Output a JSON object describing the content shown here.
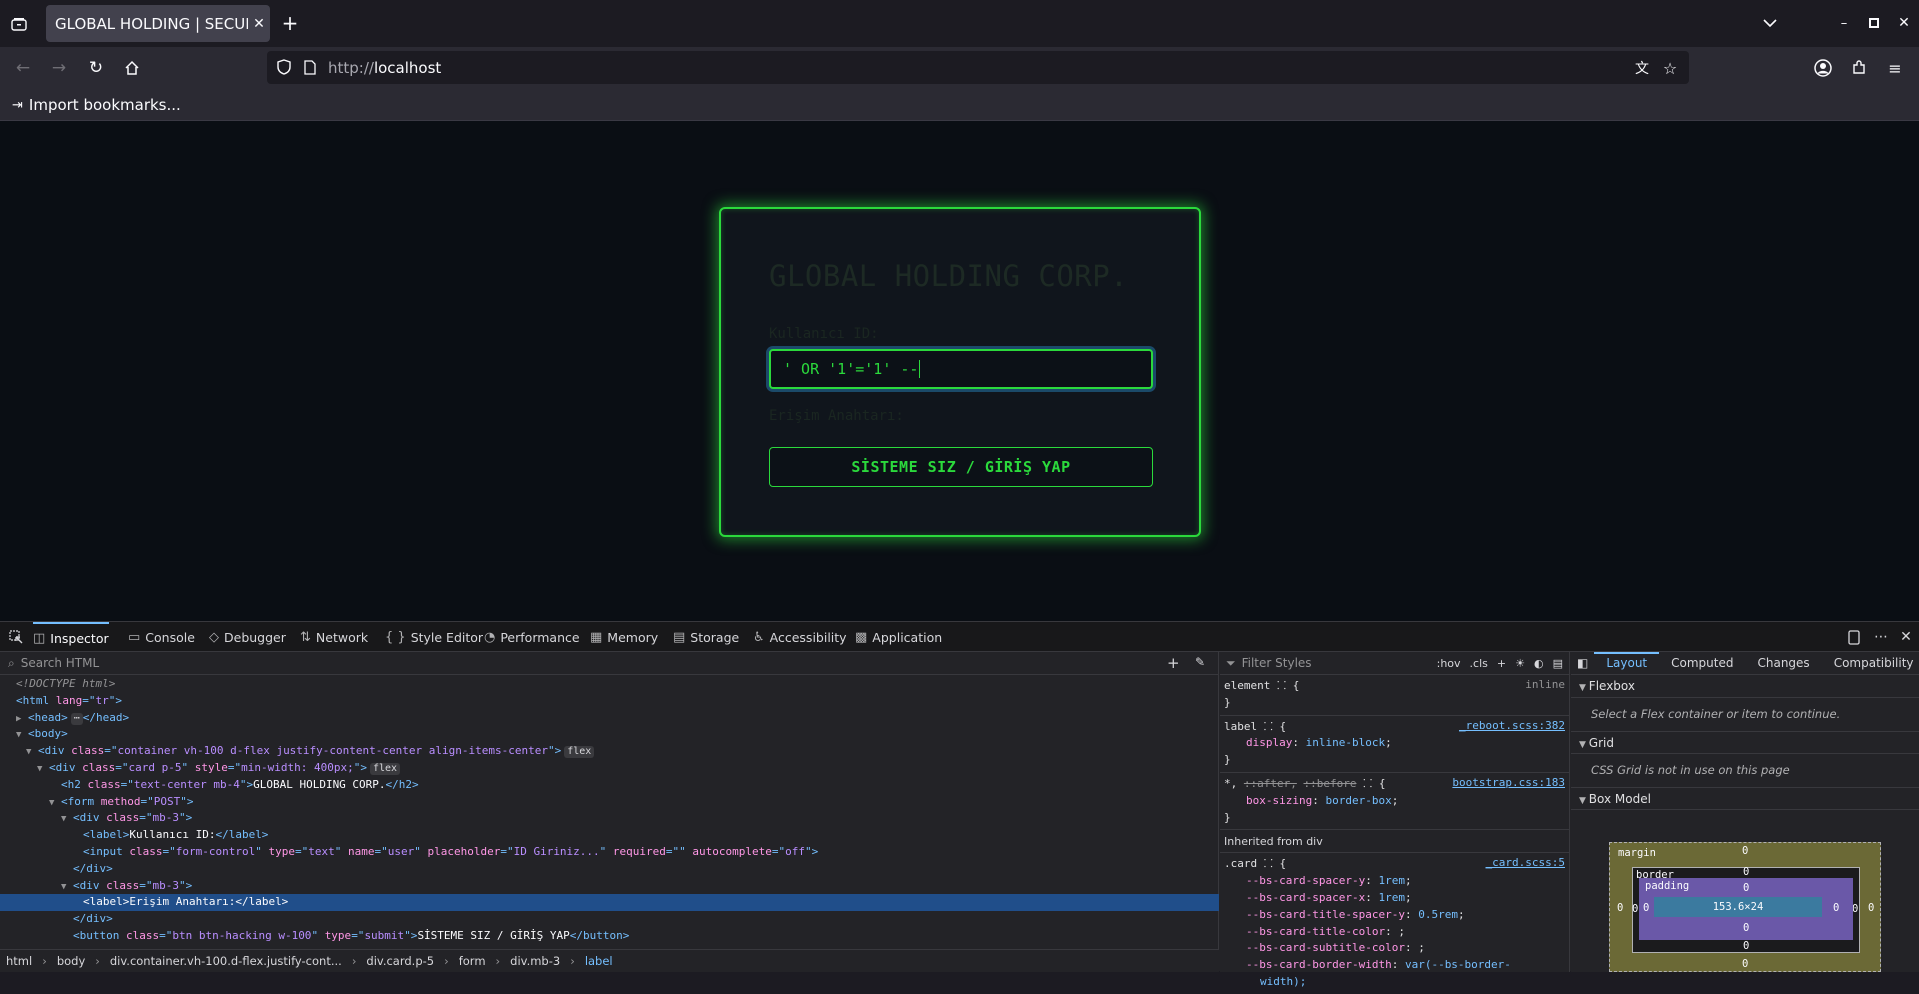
{
  "browser": {
    "tab_title": "GLOBAL HOLDING | SECURE",
    "url_protocol": "http://",
    "url_host": "localhost",
    "bookmark_label": "Import bookmarks..."
  },
  "page": {
    "title": "GLOBAL HOLDING CORP.",
    "user_label": "Kullanıcı ID:",
    "user_value": "' OR '1'='1' --",
    "pass_label": "Erişim Anahtarı:",
    "submit_label": "SİSTEME SIZ / GİRİŞ YAP",
    "accent_color": "#2bd93c"
  },
  "devtools": {
    "tabs": [
      {
        "label": "Inspector",
        "icon": "inspector-icon"
      },
      {
        "label": "Console",
        "icon": "console-icon"
      },
      {
        "label": "Debugger",
        "icon": "debugger-icon"
      },
      {
        "label": "Network",
        "icon": "network-icon"
      },
      {
        "label": "Style Editor",
        "icon": "style-editor-icon"
      },
      {
        "label": "Performance",
        "icon": "performance-icon"
      },
      {
        "label": "Memory",
        "icon": "memory-icon"
      },
      {
        "label": "Storage",
        "icon": "storage-icon"
      },
      {
        "label": "Accessibility",
        "icon": "accessibility-icon"
      },
      {
        "label": "Application",
        "icon": "application-icon"
      }
    ],
    "search_placeholder": "Search HTML",
    "filter_placeholder": "Filter Styles",
    "rules_buttons": [
      ":hov",
      ".cls"
    ],
    "html": {
      "doctype": "<!DOCTYPE html>",
      "html_lang": "tr",
      "container_class": "container vh-100 d-flex justify-content-center align-items-center",
      "card_class": "card p-5",
      "card_style": "min-width: 400px;",
      "h2_class": "text-center mb-4",
      "h2_text": "GLOBAL HOLDING CORP.",
      "form_method": "POST",
      "div_class": "mb-3",
      "label1_text": "Kullanıcı ID:",
      "input_class": "form-control",
      "input_type": "text",
      "input_name": "user",
      "input_placeholder": "ID Giriniz...",
      "input_required": "",
      "input_autocomplete": "off",
      "label2_text": "Erişim Anahtarı:",
      "button_class": "btn btn-hacking w-100",
      "button_type": "submit",
      "button_text": "SİSTEME SIZ / GİRİŞ YAP",
      "badge_flex": "flex"
    },
    "breadcrumbs": [
      "html",
      "body",
      "div.container.vh-100.d-flex.justify-cont...",
      "div.card.p-5",
      "form",
      "div.mb-3",
      "label"
    ],
    "rules": {
      "element_selector": "element",
      "element_src": "inline",
      "label_selector": "label",
      "label_src": "_reboot.scss:382",
      "label_prop": "display",
      "label_val": "inline-block",
      "star_selector_a": "*,",
      "star_selector_b": "::after,",
      "star_selector_c": "::before",
      "star_src": "bootstrap.css:183",
      "star_prop": "box-sizing",
      "star_val": "border-box",
      "inherited_label": "Inherited from div",
      "card_selector": ".card",
      "card_src": "_card.scss:5",
      "card_props": [
        {
          "name": "--bs-card-spacer-y",
          "value": "1rem"
        },
        {
          "name": "--bs-card-spacer-x",
          "value": "1rem"
        },
        {
          "name": "--bs-card-title-spacer-y",
          "value": "0.5rem"
        },
        {
          "name": "--bs-card-title-color",
          "value": ""
        },
        {
          "name": "--bs-card-subtitle-color",
          "value": ""
        },
        {
          "name": "--bs-card-border-width",
          "value": "var(--bs-border-"
        }
      ],
      "card_wrap": "width);"
    },
    "layout": {
      "tabs": [
        "Layout",
        "Computed",
        "Changes",
        "Compatibility"
      ],
      "flexbox_title": "Flexbox",
      "flexbox_msg": "Select a Flex container or item to continue.",
      "grid_title": "Grid",
      "grid_msg": "CSS Grid is not in use on this page",
      "boxmodel_title": "Box Model",
      "margin_label": "margin",
      "border_label": "border",
      "padding_label": "padding",
      "content_size": "153.6×24",
      "zero": "0"
    }
  }
}
